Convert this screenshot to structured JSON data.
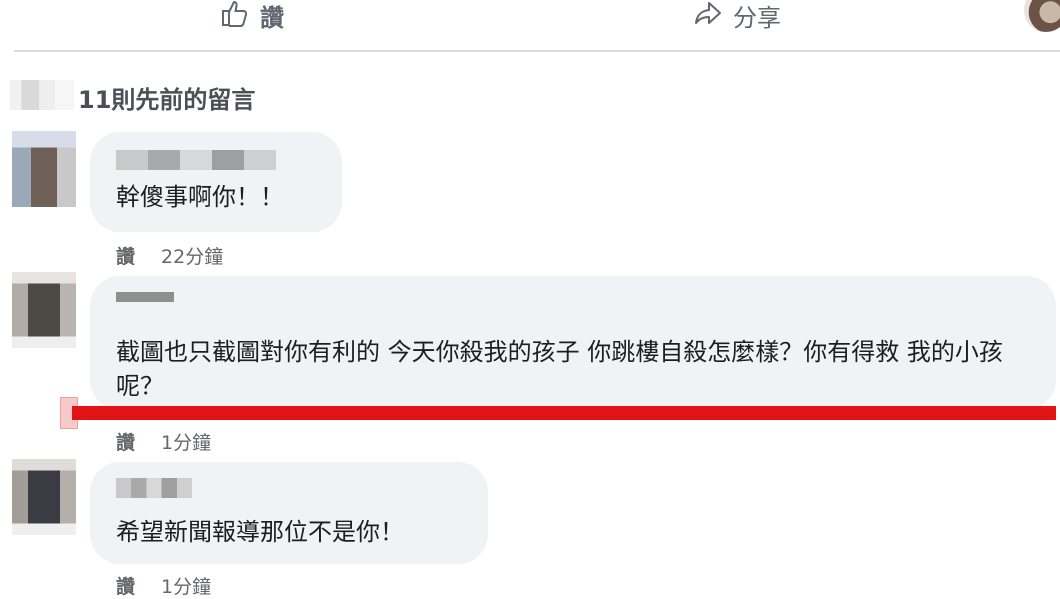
{
  "actions": {
    "like_label": "讚",
    "share_label": "分享",
    "like_icon": "thumbs-up-icon",
    "share_icon": "share-arrow-icon"
  },
  "previous_comments_label": "11則先前的留言",
  "comments": [
    {
      "text": "幹傻事啊你！！",
      "like_label": "讚",
      "time": "22分鐘"
    },
    {
      "text": "截圖也只截圖對你有利的 今天你殺我的孩子 你跳樓自殺怎麼樣？你有得救 我的小孩呢？",
      "like_label": "讚",
      "time": "1分鐘"
    },
    {
      "text": "希望新聞報導那位不是你！",
      "like_label": "讚",
      "time": "1分鐘"
    }
  ],
  "colors": {
    "bubble_bg": "#f0f2f5",
    "highlight_red": "#e01414",
    "meta_text": "#65676b"
  }
}
